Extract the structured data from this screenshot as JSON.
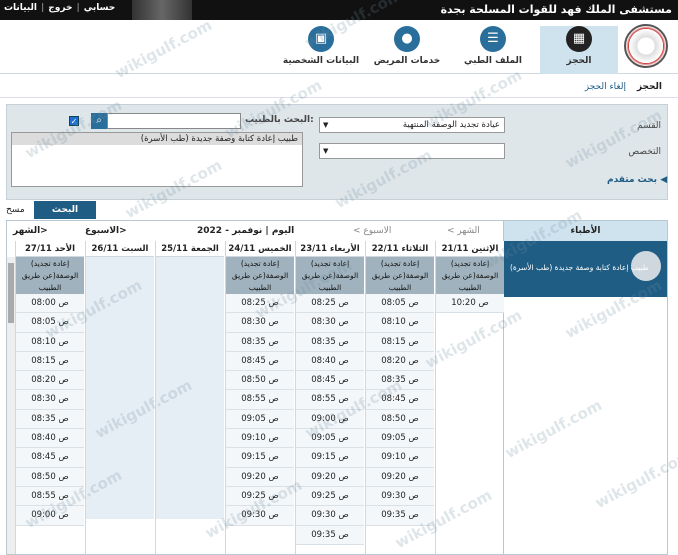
{
  "topbar": {
    "title": "مستشفى الملك فهد للقوات المسلحة بجدة",
    "links": [
      "حسابي",
      "خروج",
      "البيانات"
    ]
  },
  "tabs": [
    {
      "label": "الحجز",
      "icon": "calendar-icon",
      "active": true
    },
    {
      "label": "الملف الطبي",
      "icon": "clipboard-icon"
    },
    {
      "label": "خدمات المريض",
      "icon": "person-icon"
    },
    {
      "label": "البيانات الشخصية",
      "icon": "id-card-icon"
    }
  ],
  "subnav": {
    "booking": "الحجز",
    "cancel": "إلغاء الحجز"
  },
  "filters": {
    "department_label": "القسم",
    "department_value": "عيادة تجديد الوصفة المنتهية",
    "specialty_label": "التخصص",
    "specialty_value": "",
    "doctor_search_label": "البحث بالطبيب:",
    "doctor_search_value": "",
    "doctor_list_header": "طبيب إعادة كتابة وصفة جديدة (طب الأسرة)",
    "advanced": "بحث متقدم"
  },
  "buttons": {
    "search": "البحث",
    "clear": "مسح"
  },
  "calendar": {
    "prev_month": "< الشهر",
    "prev_week": "< الاسبوع",
    "today": "اليوم | نوفمبر - 2022",
    "next_week": "الاسبوع>",
    "next_month": "الشهر>",
    "doctors_header": "الأطباء",
    "doctor_name": "طبيب إعادة كتابة وصفة جديدة (طب الأسرة)",
    "service": "(إعادة تجديد الوصفة(عن طريق الطبيب",
    "days": [
      {
        "label": "الإثنين 21/11",
        "slots": [
          "10:20 ص"
        ]
      },
      {
        "label": "الثلاثاء 22/11",
        "slots": [
          "08:05 ص",
          "08:10 ص",
          "08:15 ص",
          "08:20 ص",
          "08:35 ص",
          "08:45 ص",
          "08:50 ص",
          "09:05 ص",
          "09:10 ص",
          "09:20 ص",
          "09:30 ص",
          "09:35 ص"
        ]
      },
      {
        "label": "الأربعاء 23/11",
        "slots": [
          "08:25 ص",
          "08:30 ص",
          "08:35 ص",
          "08:40 ص",
          "08:45 ص",
          "08:55 ص",
          "09:00 ص",
          "09:05 ص",
          "09:15 ص",
          "09:20 ص",
          "09:25 ص",
          "09:30 ص",
          "09:35 ص"
        ]
      },
      {
        "label": "الخميس 24/11",
        "slots": [
          "08:25 ص",
          "08:30 ص",
          "08:35 ص",
          "08:45 ص",
          "08:50 ص",
          "08:55 ص",
          "09:05 ص",
          "09:10 ص",
          "09:15 ص",
          "09:20 ص",
          "09:25 ص",
          "09:30 ص"
        ]
      },
      {
        "label": "الجمعة 25/11",
        "slots": []
      },
      {
        "label": "السبت 26/11",
        "slots": []
      },
      {
        "label": "الأحد 27/11",
        "slots": [
          "08:00 ص",
          "08:05 ص",
          "08:10 ص",
          "08:15 ص",
          "08:20 ص",
          "08:30 ص",
          "08:35 ص",
          "08:40 ص",
          "08:45 ص",
          "08:50 ص",
          "08:55 ص",
          "09:00 ص"
        ]
      }
    ]
  },
  "watermark": "wikigulf.com"
}
